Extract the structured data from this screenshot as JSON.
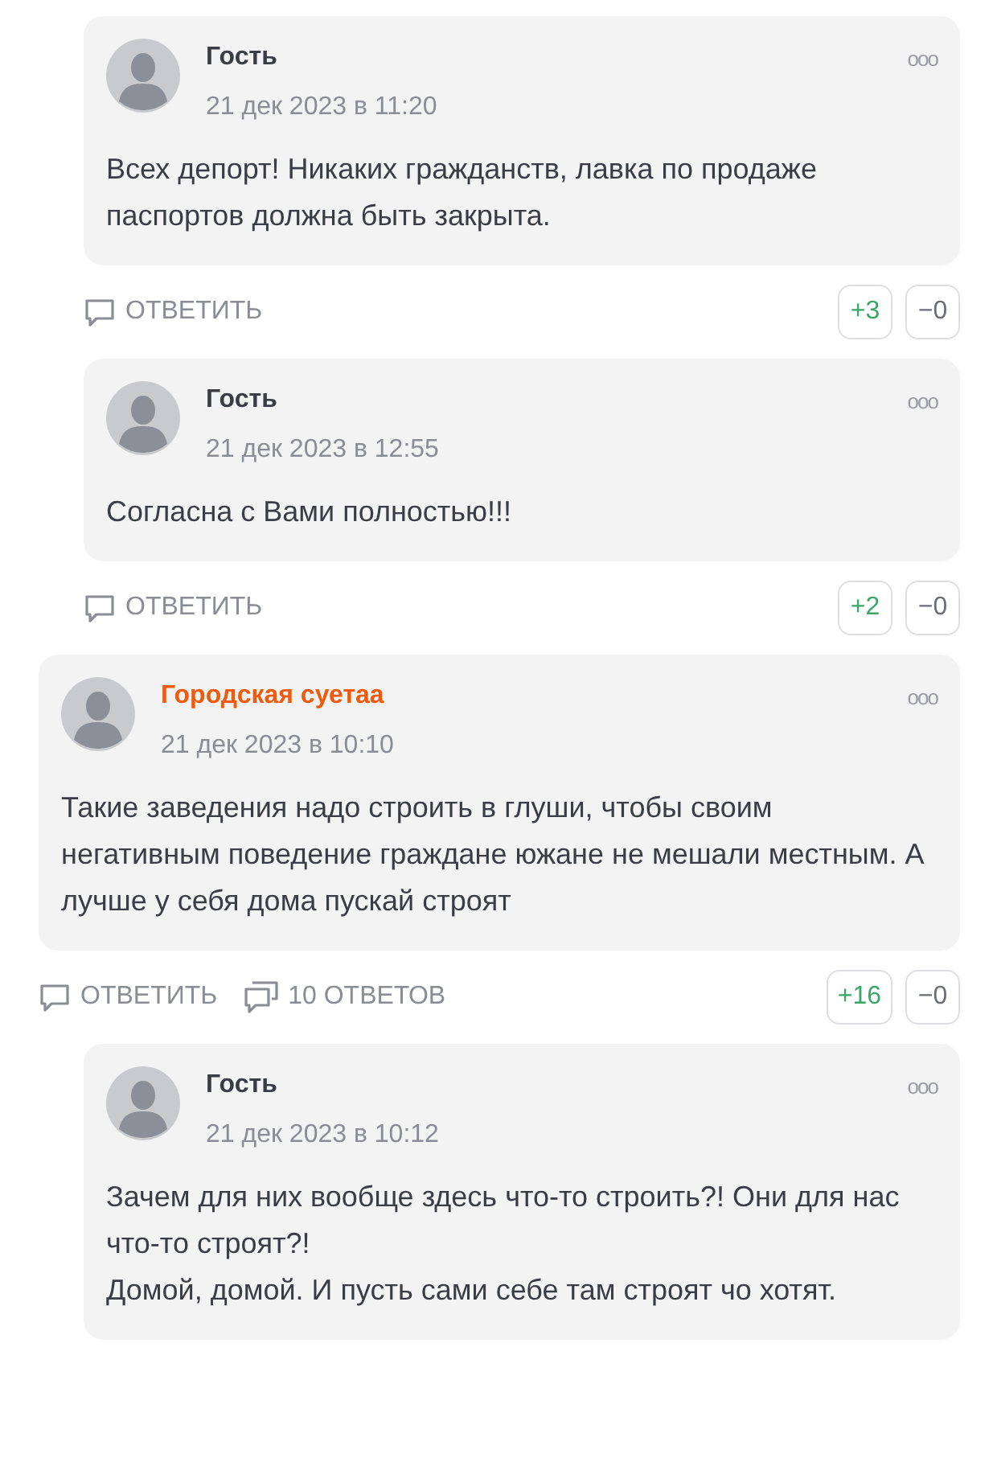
{
  "comments": [
    {
      "kind": "reply",
      "author": "Гость",
      "color": "#3a3d44",
      "date": "21 дек 2023 в 11:20",
      "menu": "ooo",
      "text": "Всех депорт! Никаких гражданств, лавка по продаже паспортов должна быть закрыта.",
      "reply_label": "ОТВЕТИТЬ",
      "likes": "+3",
      "dislikes": "−0"
    },
    {
      "kind": "reply",
      "author": "Гость",
      "color": "#3a3d44",
      "date": "21 дек 2023 в 12:55",
      "menu": "ooo",
      "text": "Согласна с Вами полностью!!!",
      "reply_label": "ОТВЕТИТЬ",
      "likes": "+2",
      "dislikes": "−0"
    },
    {
      "kind": "top",
      "author": "Городская суетаа",
      "color": "#f05a0c",
      "date": "21 дек 2023 в 10:10",
      "menu": "ooo",
      "text": "Такие заведения надо строить в глуши, чтобы своим негативным поведение граждане южане не мешали местным. А лучше у себя дома пускай строят",
      "reply_label": "ОТВЕТИТЬ",
      "replies_label": "10 ОТВЕТОВ",
      "likes": "+16",
      "dislikes": "−0",
      "children": [
        {
          "kind": "reply",
          "author": "Гость",
          "color": "#3a3d44",
          "date": "21 дек 2023 в 10:12",
          "menu": "ooo",
          "text": "Зачем для них вообще здесь что-то строить?! Они для нас что-то строят?!\nДомой, домой. И пусть сами себе там строят чо хотят."
        }
      ]
    }
  ]
}
